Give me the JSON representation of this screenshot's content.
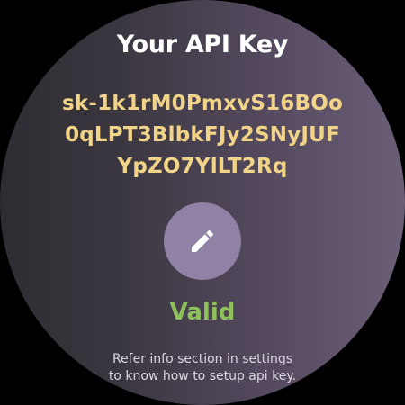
{
  "screen": {
    "title": "Your API Key",
    "api_key_lines": [
      "sk-1k1rM0PmxvS16BOo",
      "0qLPT3BlbkFJy2SNyJUF",
      "YpZO7YlLT2Rq"
    ],
    "edit_icon": "pencil-icon",
    "status": "Valid",
    "info_lines": [
      "Refer info section in settings",
      "to know how to setup api key."
    ]
  },
  "colors": {
    "api_key": "#f1d487",
    "status_valid": "#8ec05c",
    "button_bg": "#8f82a5"
  }
}
